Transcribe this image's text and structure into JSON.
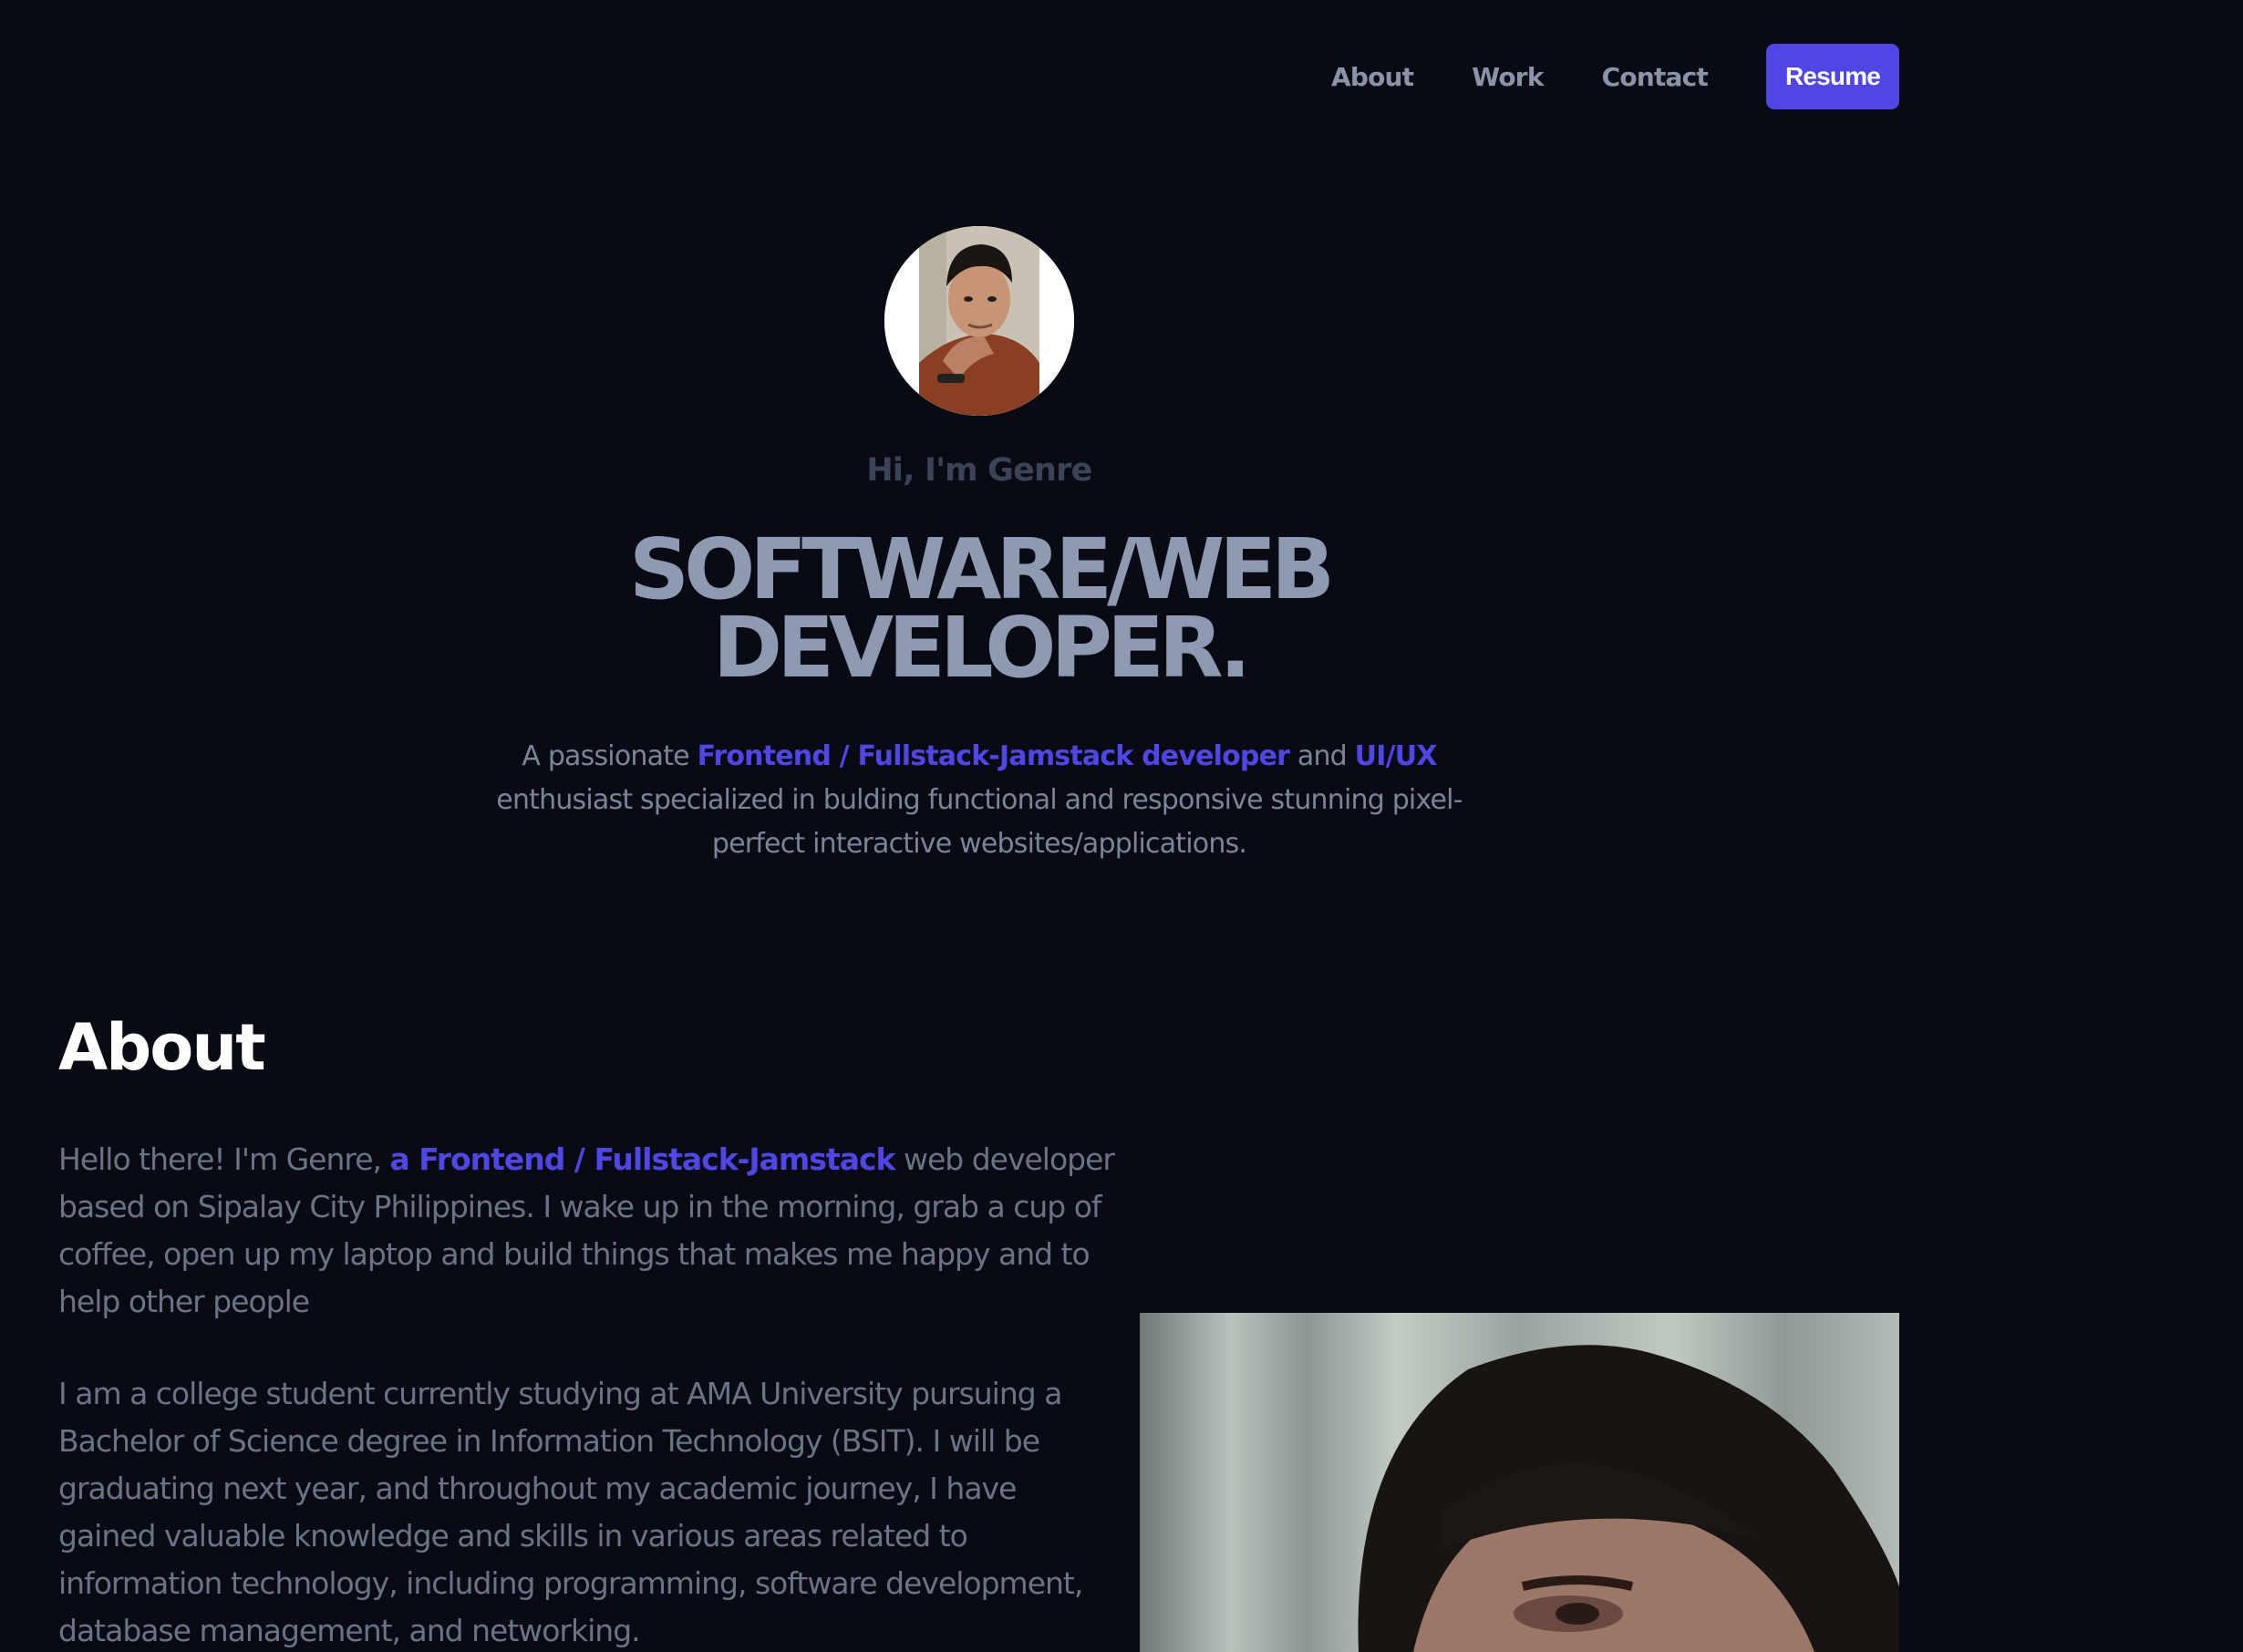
{
  "nav": {
    "links": [
      "About",
      "Work",
      "Contact"
    ],
    "resume_label": "Resume"
  },
  "hero": {
    "greeting": "Hi, I'm Genre",
    "headline_line1": "SOFTWARE/WEB",
    "headline_line2": "DEVELOPER.",
    "intro_prefix": "A passionate ",
    "intro_accent1": "Frontend / Fullstack-Jamstack developer",
    "intro_mid": " and ",
    "intro_accent2": "UI/UX",
    "intro_suffix": " enthusiast specialized in bulding functional and responsive stunning pixel-perfect interactive websites/applications."
  },
  "about": {
    "title": "About",
    "p1_prefix": "Hello there! I'm Genre, ",
    "p1_accent": "a Frontend / Fullstack-Jamstack",
    "p1_suffix": " web developer based on Sipalay City Philippines. I wake up in the morning, grab a cup of coffee, open up my laptop and build things that makes me happy and to help other people",
    "p2": "I am a college student currently studying at AMA University pursuing a Bachelor of Science degree in Information Technology (BSIT). I will be graduating next year, and throughout my academic journey, I have gained valuable knowledge and skills in various areas related to information technology, including programming, software development, database management, and networking."
  },
  "colors": {
    "background": "#080b14",
    "accent": "#4f46e5",
    "headline": "#8e9ab2",
    "body_text": "#6b7386"
  }
}
